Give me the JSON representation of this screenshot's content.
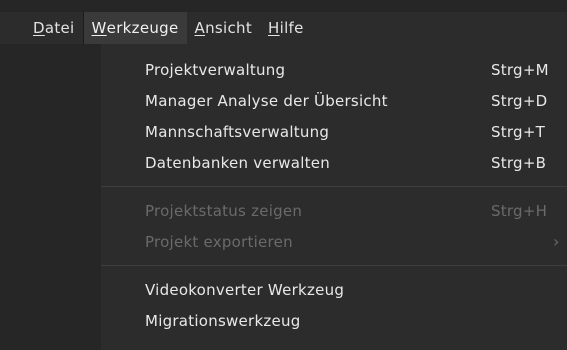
{
  "menubar": {
    "items": [
      {
        "pre": "",
        "accel": "D",
        "post": "atei"
      },
      {
        "pre": "",
        "accel": "W",
        "post": "erkzeuge"
      },
      {
        "pre": "",
        "accel": "A",
        "post": "nsicht"
      },
      {
        "pre": "",
        "accel": "H",
        "post": "ilfe"
      }
    ]
  },
  "menu": {
    "group1": [
      {
        "label": "Projektverwaltung",
        "shortcut": "Strg+M"
      },
      {
        "label": "Manager Analyse der Übersicht",
        "shortcut": "Strg+D"
      },
      {
        "label": "Mannschaftsverwaltung",
        "shortcut": "Strg+T"
      },
      {
        "label": "Datenbanken verwalten",
        "shortcut": "Strg+B"
      }
    ],
    "group2": [
      {
        "label": "Projektstatus zeigen",
        "shortcut": "Strg+H"
      },
      {
        "label": "Projekt exportieren",
        "chevron": "›"
      }
    ],
    "group3": [
      {
        "label": "Videokonverter Werkzeug"
      },
      {
        "label": "Migrationswerkzeug"
      }
    ]
  },
  "colors": {
    "background": "#262626",
    "menu_bg": "#2c2c2c",
    "active_bg": "#3a3a3a",
    "text": "#e8e8e8",
    "disabled_text": "#6a6a6a"
  },
  "icons": {
    "submenu_arrow": "chevron-right-icon"
  }
}
